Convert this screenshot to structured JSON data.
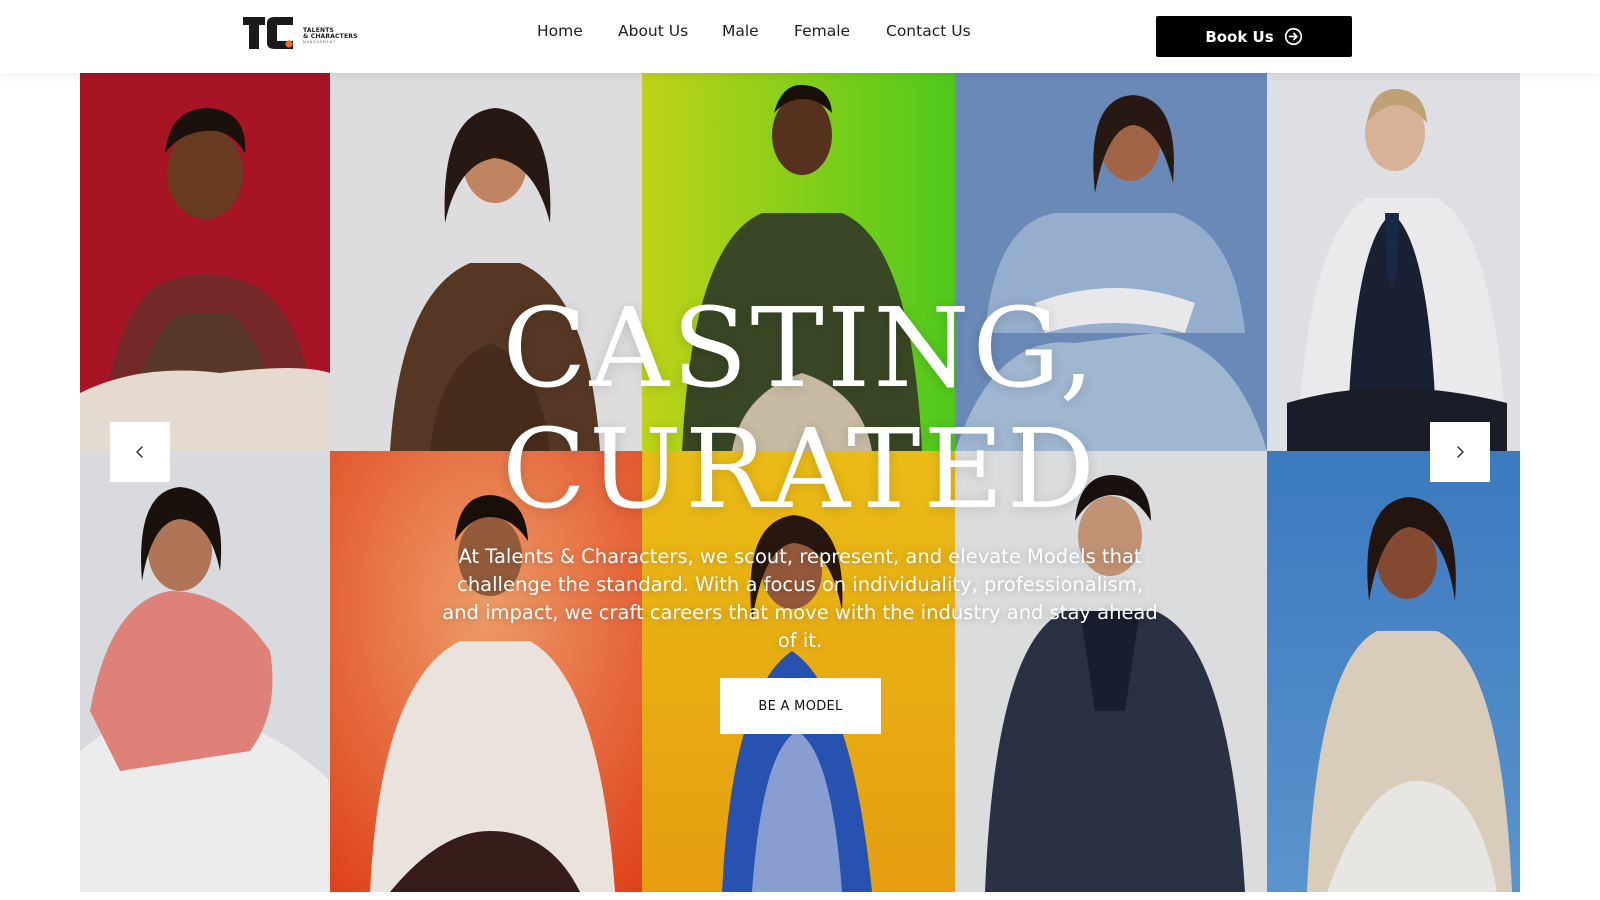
{
  "header": {
    "logo": {
      "line1": "TALENTS",
      "line2": "& CHARACTERS",
      "line3": "MANAGEMENT"
    },
    "nav": [
      "Home",
      "About Us",
      "Male",
      "Female",
      "Contact Us"
    ],
    "book_label": "Book Us",
    "book_icon": "arrow-circle-right-icon"
  },
  "hero": {
    "title_line1": "CASTING,",
    "title_line2": "CURATED",
    "description": "At Talents & Characters, we scout, represent, and elevate Models that challenge the standard. With a focus on individuality, professionalism, and impact, we craft careers that move with the industry and stay ahead of it.",
    "cta_label": "BE A MODEL",
    "prev_icon": "chevron-left-icon",
    "next_icon": "chevron-right-icon"
  },
  "colors": {
    "panel_red": "#b5172a",
    "panel_white": "#e6e7e9",
    "panel_green": "#6fd62a",
    "panel_blue": "#6f8fbf",
    "panel_orange": "#ef5a2a",
    "panel_yellow": "#f2c614",
    "panel_sky": "#3f82c8",
    "button_dark": "#000000"
  }
}
